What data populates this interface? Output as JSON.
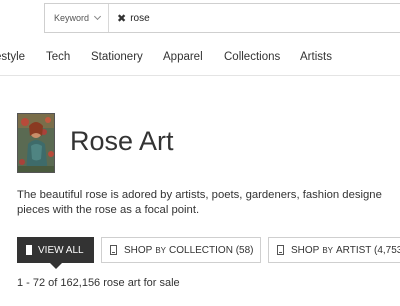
{
  "search": {
    "keyword_label": "Keyword",
    "token": "rose"
  },
  "nav": {
    "items": [
      "estyle",
      "Tech",
      "Stationery",
      "Apparel",
      "Collections",
      "Artists"
    ]
  },
  "header": {
    "title": "Rose Art"
  },
  "description": {
    "line1": "The beautiful rose is adored by artists, poets, gardeners, fashion designe",
    "line2": "pieces with the rose as a focal point."
  },
  "buttons": {
    "view_all": "VIEW ALL",
    "collection_pre": "SHOP",
    "collection_by": "BY",
    "collection_post": "COLLECTION (58)",
    "artist_pre": "SHOP",
    "artist_by": "BY",
    "artist_post": "ARTIST (4,753"
  },
  "results": {
    "text": "1 - 72 of 162,156 rose art for sale"
  }
}
